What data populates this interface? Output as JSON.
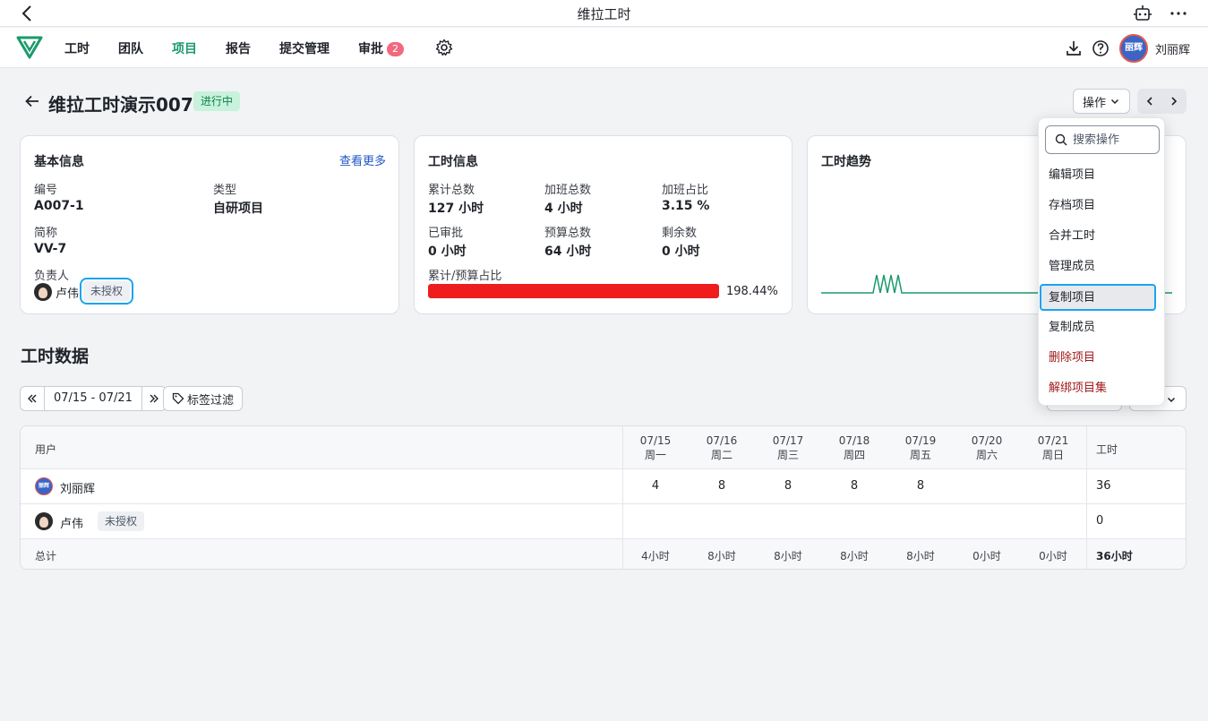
{
  "window": {
    "title": "维拉工时"
  },
  "nav": {
    "items": [
      {
        "label": "工时"
      },
      {
        "label": "团队"
      },
      {
        "label": "项目"
      },
      {
        "label": "报告"
      },
      {
        "label": "提交管理"
      },
      {
        "label": "审批"
      }
    ],
    "approval_badge": "2",
    "user": {
      "name": "刘丽辉",
      "avatar_text": "丽辉"
    }
  },
  "project": {
    "title": "维拉工时演示007",
    "status": "进行中",
    "ops_label": "操作"
  },
  "basic_info": {
    "title": "基本信息",
    "more_link": "查看更多",
    "code_label": "编号",
    "code": "A007-1",
    "type_label": "类型",
    "type": "自研项目",
    "short_label": "简称",
    "short": "VV-7",
    "owner_label": "负责人",
    "owner": "卢伟",
    "owner_tag": "未授权"
  },
  "hours_info": {
    "title": "工时信息",
    "total_label": "累计总数",
    "total": "127 小时",
    "overtime_label": "加班总数",
    "overtime": "4 小时",
    "ratio_label": "加班占比",
    "ratio": "3.15 %",
    "approved_label": "已审批",
    "approved": "0 小时",
    "budget_label": "预算总数",
    "budget": "64 小时",
    "remain_label": "剩余数",
    "remain": "0 小时",
    "progress_label": "累计/预算占比",
    "progress": "198.44%",
    "progress_fill": 1.0
  },
  "trend": {
    "title": "工时趋势",
    "line_color": "#1b9a6b"
  },
  "section": {
    "title": "工时数据",
    "date_range": "07/15 - 07/21",
    "tag_filter": "标签过滤"
  },
  "table": {
    "user_header": "用户",
    "hours_header": "工时",
    "days": [
      {
        "date": "07/15",
        "weekday": "周一"
      },
      {
        "date": "07/16",
        "weekday": "周二"
      },
      {
        "date": "07/17",
        "weekday": "周三"
      },
      {
        "date": "07/18",
        "weekday": "周四"
      },
      {
        "date": "07/19",
        "weekday": "周五"
      },
      {
        "date": "07/20",
        "weekday": "周六"
      },
      {
        "date": "07/21",
        "weekday": "周日"
      }
    ],
    "rows": [
      {
        "name": "刘丽辉",
        "tag": "",
        "values": [
          "4",
          "8",
          "8",
          "8",
          "8",
          "",
          ""
        ],
        "total": "36"
      },
      {
        "name": "卢伟",
        "tag": "未授权",
        "values": [
          "",
          "",
          "",
          "",
          "",
          "",
          ""
        ],
        "total": "0"
      }
    ],
    "footer_label": "总计",
    "footer_values": [
      "4小时",
      "8小时",
      "8小时",
      "8小时",
      "8小时",
      "0小时",
      "0小时"
    ],
    "footer_total": "36小时"
  },
  "dropdown": {
    "search_placeholder": "搜索操作",
    "items": [
      {
        "label": "编辑项目"
      },
      {
        "label": "存档项目"
      },
      {
        "label": "合并工时"
      },
      {
        "label": "管理成员"
      },
      {
        "label": "复制项目"
      },
      {
        "label": "复制成员"
      },
      {
        "label": "删除项目"
      },
      {
        "label": "解绑项目集"
      }
    ]
  },
  "colors": {
    "accent": "#1b9a6b",
    "danger": "#ee1c1c",
    "highlight": "#19a4f0",
    "badge": "#f06a7e"
  }
}
